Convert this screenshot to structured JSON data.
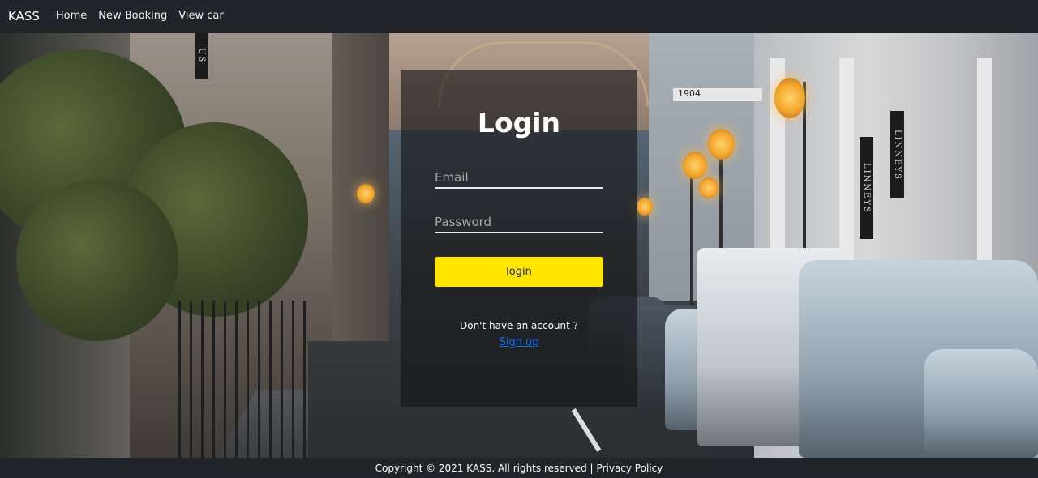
{
  "navbar": {
    "brand": "KASS",
    "links": [
      "Home",
      "New Booking",
      "View car"
    ]
  },
  "login": {
    "title": "Login",
    "email_placeholder": "Email",
    "password_placeholder": "Password",
    "button_label": "login",
    "signup_prompt": "Don't have an account ?",
    "signup_link": "Sign up"
  },
  "footer": {
    "copyright": "Copyright © 2021 KASS. All rights reserved |",
    "privacy": "Privacy Policy"
  },
  "background_signs": {
    "left_sign": "US",
    "right_sign_1": "LINNEYS",
    "right_sign_2": "LINNEYS",
    "building_year": "1904"
  },
  "colors": {
    "navbar_bg": "#212529",
    "button_bg": "#ffe500",
    "link": "#0d6efd"
  }
}
